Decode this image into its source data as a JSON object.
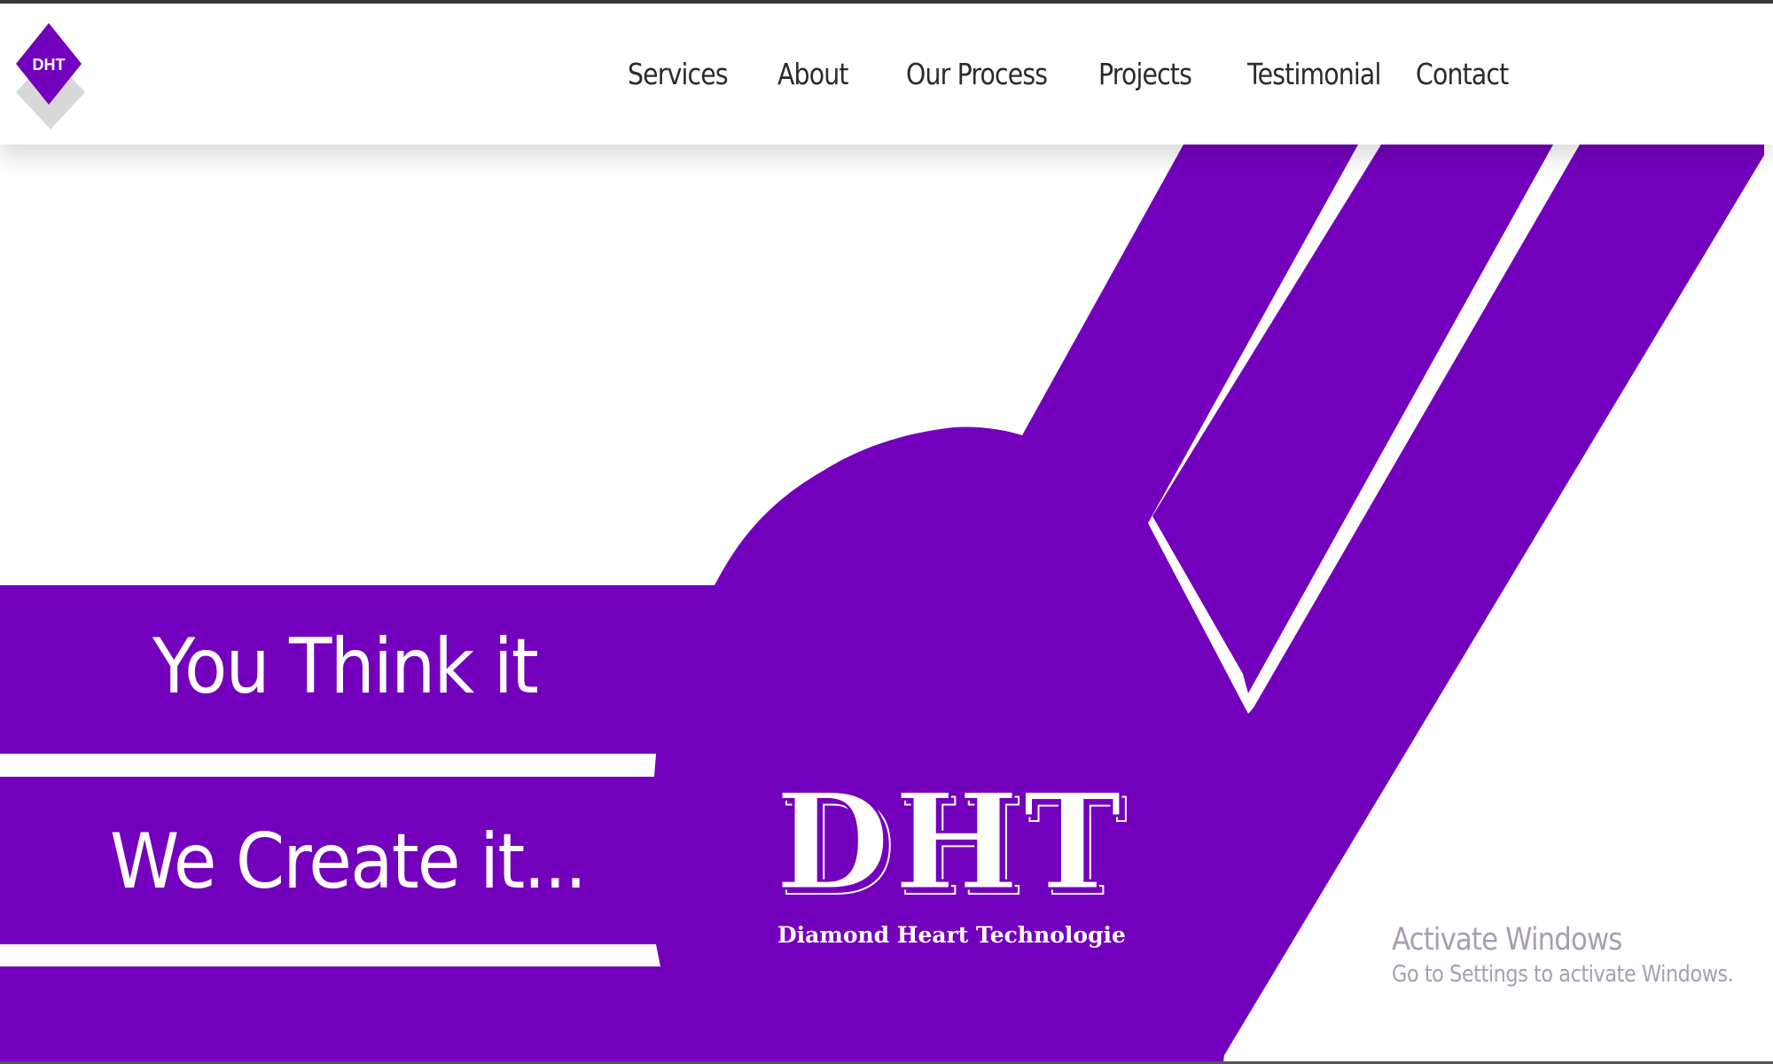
{
  "colors": {
    "brand_purple": "#7300BD",
    "nav_text": "#2b2b2b",
    "hero_text": "#ffffff",
    "watermark_text": "#a79fb0"
  },
  "logo": {
    "text": "DHT",
    "icon": "diamond-logo-icon"
  },
  "nav": {
    "items": [
      {
        "label": "Services"
      },
      {
        "label": "About"
      },
      {
        "label": "Our Process"
      },
      {
        "label": "Projects"
      },
      {
        "label": "Testimonial"
      },
      {
        "label": "Contact"
      }
    ]
  },
  "hero": {
    "line1": "You Think it",
    "line2": "We Create it...",
    "brand_mark": "DHT",
    "brand_name": "Diamond Heart Technologie"
  },
  "watermark": {
    "title": "Activate Windows",
    "subtitle": "Go to Settings to activate Windows."
  }
}
